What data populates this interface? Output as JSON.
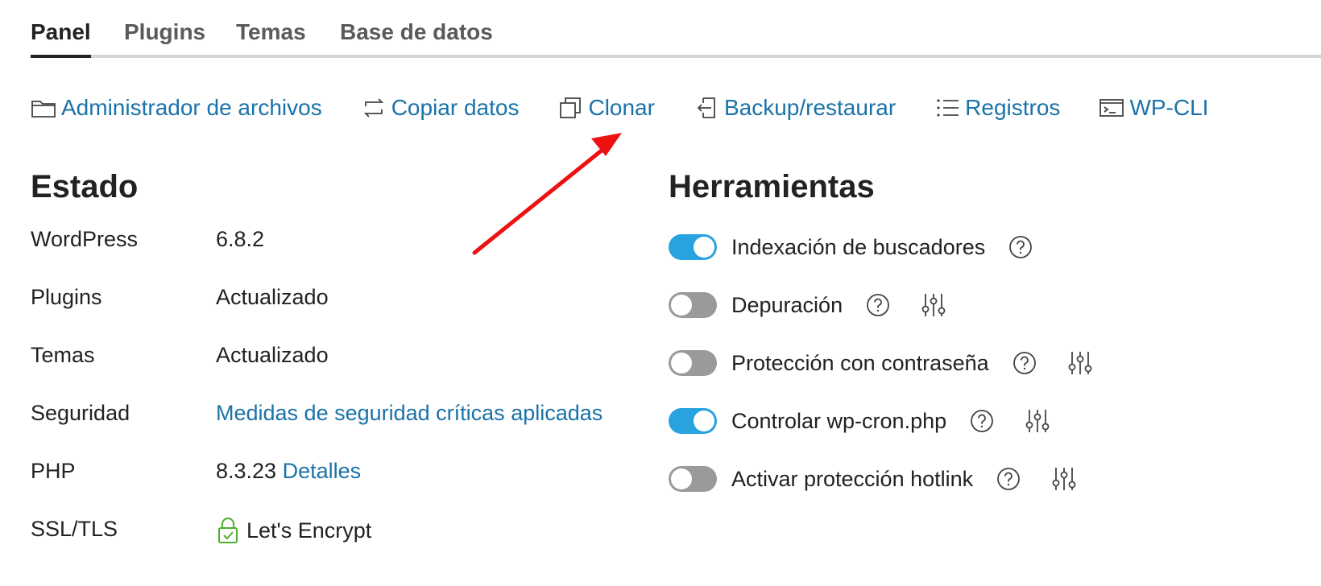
{
  "tabs": [
    {
      "label": "Panel",
      "active": true
    },
    {
      "label": "Plugins",
      "active": false
    },
    {
      "label": "Temas",
      "active": false
    },
    {
      "label": "Base de datos",
      "active": false
    }
  ],
  "actions": [
    {
      "label": "Administrador de archivos",
      "icon": "folder-icon"
    },
    {
      "label": "Copiar datos",
      "icon": "copy-sync-icon"
    },
    {
      "label": "Clonar",
      "icon": "clone-icon"
    },
    {
      "label": "Backup/restaurar",
      "icon": "backup-restore-icon"
    },
    {
      "label": "Registros",
      "icon": "list-icon"
    },
    {
      "label": "WP-CLI",
      "icon": "terminal-icon"
    }
  ],
  "status": {
    "title": "Estado",
    "rows": [
      {
        "key": "WordPress",
        "value": "6.8.2"
      },
      {
        "key": "Plugins",
        "value": "Actualizado"
      },
      {
        "key": "Temas",
        "value": "Actualizado"
      },
      {
        "key": "Seguridad",
        "value": "Medidas de seguridad críticas aplicadas"
      },
      {
        "key": "PHP",
        "value": "8.3.23",
        "link": "Detalles"
      },
      {
        "key": "SSL/TLS",
        "value": "Let's Encrypt",
        "icon": "lock-check-icon"
      }
    ]
  },
  "tools": {
    "title": "Herramientas",
    "items": [
      {
        "label": "Indexación de buscadores",
        "enabled": true,
        "settings": false
      },
      {
        "label": "Depuración",
        "enabled": false,
        "settings": true
      },
      {
        "label": "Protección con contraseña",
        "enabled": false,
        "settings": true
      },
      {
        "label": "Controlar wp-cron.php",
        "enabled": true,
        "settings": true
      },
      {
        "label": "Activar protección hotlink",
        "enabled": false,
        "settings": true
      }
    ]
  },
  "colors": {
    "link": "#1a73a8",
    "toggle_on": "#29a3e0",
    "toggle_off": "#9a9a9a",
    "lock": "#4caf2f",
    "arrow": "#ee1111"
  }
}
